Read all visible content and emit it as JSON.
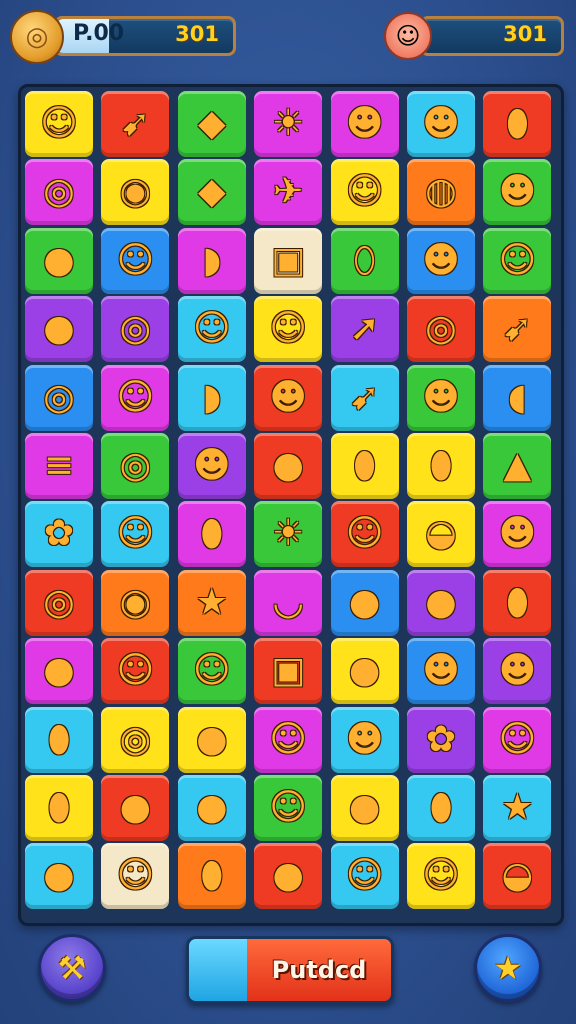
{
  "hud": {
    "coin_icon": "coin-icon",
    "coins_value": "P.00",
    "coins_score": "301",
    "avatar_icon": "avatar-icon",
    "player_score": "301"
  },
  "palette": {
    "red": "#ef3b23",
    "orange": "#ff7a1a",
    "yellow": "#ffe21a",
    "green": "#38c83a",
    "cyan": "#35c8f0",
    "blue": "#2a8ff0",
    "magenta": "#e03ae6",
    "purple": "#9a40e6",
    "cream": "#f5e8c8"
  },
  "board": {
    "rows": [
      [
        {
          "c": "yellow",
          "g": "☺",
          "n": "fox-face-icon"
        },
        {
          "c": "red",
          "g": "➹",
          "n": "carrot-icon"
        },
        {
          "c": "green",
          "g": "◆",
          "n": "bread-icon"
        },
        {
          "c": "magenta",
          "g": "☀",
          "n": "sun-face-icon"
        },
        {
          "c": "magenta",
          "g": "☻",
          "n": "bear-face-icon"
        },
        {
          "c": "cyan",
          "g": "☻",
          "n": "frog-face-icon"
        },
        {
          "c": "red",
          "g": "⬮",
          "n": "leaf-icon"
        }
      ],
      [
        {
          "c": "magenta",
          "g": "◎",
          "n": "coin-stack-icon"
        },
        {
          "c": "yellow",
          "g": "◉",
          "n": "lemon-icon"
        },
        {
          "c": "green",
          "g": "◆",
          "n": "cheese-icon"
        },
        {
          "c": "magenta",
          "g": "✈",
          "n": "fox-jet-icon"
        },
        {
          "c": "yellow",
          "g": "☺",
          "n": "lion-face-icon"
        },
        {
          "c": "orange",
          "g": "◍",
          "n": "ham-icon"
        },
        {
          "c": "green",
          "g": "☻",
          "n": "moose-face-icon"
        }
      ],
      [
        {
          "c": "green",
          "g": "●",
          "n": "apple-icon"
        },
        {
          "c": "blue",
          "g": "☺",
          "n": "winged-fox-icon"
        },
        {
          "c": "magenta",
          "g": "◗",
          "n": "lemon-slice-icon"
        },
        {
          "c": "cream",
          "g": "▣",
          "n": "treasure-chest-icon"
        },
        {
          "c": "green",
          "g": "⬯",
          "n": "blue-fish-icon"
        },
        {
          "c": "blue",
          "g": "☻",
          "n": "pink-bear-icon"
        },
        {
          "c": "green",
          "g": "☺",
          "n": "sun-face-small-icon"
        }
      ],
      [
        {
          "c": "purple",
          "g": "●",
          "n": "coconut-icon"
        },
        {
          "c": "purple",
          "g": "◎",
          "n": "pineapple-ring-icon"
        },
        {
          "c": "cyan",
          "g": "☺",
          "n": "cat-face-icon"
        },
        {
          "c": "yellow",
          "g": "☺",
          "n": "lion-mane-icon"
        },
        {
          "c": "purple",
          "g": "➚",
          "n": "lipstick-icon"
        },
        {
          "c": "red",
          "g": "◎",
          "n": "spiral-shell-icon"
        },
        {
          "c": "orange",
          "g": "➹",
          "n": "carrot-slice-icon"
        }
      ],
      [
        {
          "c": "blue",
          "g": "◎",
          "n": "green-swirl-icon"
        },
        {
          "c": "magenta",
          "g": "☺",
          "n": "orange-winged-icon"
        },
        {
          "c": "cyan",
          "g": "◗",
          "n": "cheese-wedge-icon"
        },
        {
          "c": "red",
          "g": "☻",
          "n": "green-frog-icon"
        },
        {
          "c": "cyan",
          "g": "➹",
          "n": "corn-icon"
        },
        {
          "c": "green",
          "g": "☻",
          "n": "monkey-face-icon"
        },
        {
          "c": "blue",
          "g": "◖",
          "n": "pink-blob-icon"
        }
      ],
      [
        {
          "c": "magenta",
          "g": "≡",
          "n": "burger-stack-icon"
        },
        {
          "c": "green",
          "g": "◎",
          "n": "donut-icon"
        },
        {
          "c": "purple",
          "g": "☻",
          "n": "green-creature-icon"
        },
        {
          "c": "red",
          "g": "●",
          "n": "strawberry-icon"
        },
        {
          "c": "yellow",
          "g": "⬮",
          "n": "mango-icon"
        },
        {
          "c": "yellow",
          "g": "⬮",
          "n": "radish-icon"
        },
        {
          "c": "green",
          "g": "▲",
          "n": "blue-pear-icon"
        }
      ],
      [
        {
          "c": "cyan",
          "g": "✿",
          "n": "cactus-icon"
        },
        {
          "c": "cyan",
          "g": "☺",
          "n": "winged-sun-icon"
        },
        {
          "c": "magenta",
          "g": "⬮",
          "n": "banana-icon"
        },
        {
          "c": "green",
          "g": "☀",
          "n": "green-lion-icon"
        },
        {
          "c": "red",
          "g": "☺",
          "n": "bear-cub-icon"
        },
        {
          "c": "yellow",
          "g": "◒",
          "n": "green-bowl-icon"
        },
        {
          "c": "magenta",
          "g": "☻",
          "n": "pink-pig-icon"
        }
      ],
      [
        {
          "c": "red",
          "g": "◎",
          "n": "cyan-swirl-icon"
        },
        {
          "c": "orange",
          "g": "◉",
          "n": "melon-icon"
        },
        {
          "c": "orange",
          "g": "★",
          "n": "star-fruit-icon"
        },
        {
          "c": "magenta",
          "g": "◡",
          "n": "teacup-icon"
        },
        {
          "c": "blue",
          "g": "●",
          "n": "tomato-icon"
        },
        {
          "c": "purple",
          "g": "●",
          "n": "cookie-icon"
        },
        {
          "c": "red",
          "g": "⬮",
          "n": "baguette-icon"
        }
      ],
      [
        {
          "c": "magenta",
          "g": "●",
          "n": "orange-ball-icon"
        },
        {
          "c": "red",
          "g": "☺",
          "n": "purple-winged-icon"
        },
        {
          "c": "green",
          "g": "☺",
          "n": "fox-cub-icon"
        },
        {
          "c": "red",
          "g": "▣",
          "n": "gift-box-icon"
        },
        {
          "c": "yellow",
          "g": "●",
          "n": "strawberry-slice-icon"
        },
        {
          "c": "blue",
          "g": "☻",
          "n": "blue-bear-icon"
        },
        {
          "c": "purple",
          "g": "☻",
          "n": "grey-cat-icon"
        }
      ],
      [
        {
          "c": "cyan",
          "g": "⬮",
          "n": "sausage-icon"
        },
        {
          "c": "yellow",
          "g": "◎",
          "n": "red-donut-icon"
        },
        {
          "c": "yellow",
          "g": "●",
          "n": "red-apple-icon"
        },
        {
          "c": "magenta",
          "g": "☺",
          "n": "tiger-face-icon"
        },
        {
          "c": "cyan",
          "g": "☻",
          "n": "green-alien-icon"
        },
        {
          "c": "purple",
          "g": "✿",
          "n": "pineapple-icon"
        },
        {
          "c": "magenta",
          "g": "☺",
          "n": "golden-cat-icon"
        }
      ],
      [
        {
          "c": "yellow",
          "g": "⬮",
          "n": "pea-pod-icon"
        },
        {
          "c": "red",
          "g": "●",
          "n": "big-strawberry-icon"
        },
        {
          "c": "cyan",
          "g": "●",
          "n": "cherry-icon"
        },
        {
          "c": "green",
          "g": "☺",
          "n": "lion-head-icon"
        },
        {
          "c": "yellow",
          "g": "●",
          "n": "orange-fruit-icon"
        },
        {
          "c": "cyan",
          "g": "⬮",
          "n": "eggplant-icon"
        },
        {
          "c": "cyan",
          "g": "★",
          "n": "pink-star-icon"
        }
      ],
      [
        {
          "c": "cyan",
          "g": "●",
          "n": "brown-nut-icon"
        },
        {
          "c": "cream",
          "g": "☺",
          "n": "cream-winged-icon"
        },
        {
          "c": "orange",
          "g": "⬮",
          "n": "pear-icon"
        },
        {
          "c": "red",
          "g": "●",
          "n": "red-tomato-icon"
        },
        {
          "c": "cyan",
          "g": "☺",
          "n": "monkey-icon"
        },
        {
          "c": "yellow",
          "g": "☺",
          "n": "pig-face-icon"
        },
        {
          "c": "red",
          "g": "◒",
          "n": "pudding-bowl-icon"
        }
      ]
    ]
  },
  "controls": {
    "left_button_icon": "hammer-icon",
    "left_button_glyph": "⚒",
    "action_label": "Putdcd",
    "right_button_icon": "star-icon",
    "right_button_glyph": "★"
  }
}
